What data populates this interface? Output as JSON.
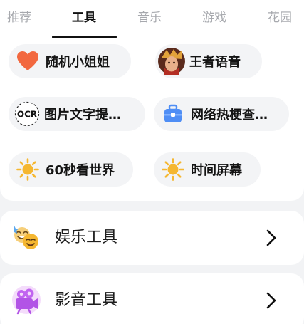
{
  "tabs": [
    {
      "label": "推荐",
      "active": false
    },
    {
      "label": "工具",
      "active": true
    },
    {
      "label": "音乐",
      "active": false
    },
    {
      "label": "游戏",
      "active": false
    },
    {
      "label": "花园",
      "active": false
    }
  ],
  "chips": [
    {
      "label": "随机小姐姐",
      "icon": "heart-icon"
    },
    {
      "label": "王者语音",
      "icon": "game-hero-avatar-icon"
    },
    {
      "label": "图片文字提…",
      "icon": "ocr-icon",
      "icon_text": "OCR"
    },
    {
      "label": "网络热梗查…",
      "icon": "toolbox-icon"
    },
    {
      "label": "60秒看世界",
      "icon": "sun-icon"
    },
    {
      "label": "时间屏幕",
      "icon": "sun-icon"
    }
  ],
  "list": [
    {
      "label": "娱乐工具",
      "icon": "entertainment-emoji-icon"
    },
    {
      "label": "影音工具",
      "icon": "video-camera-icon"
    }
  ],
  "colors": {
    "heart": "#f2683f",
    "sun": "#f5b731",
    "toolbox": "#4f8ef5",
    "video": "#c164f0",
    "active_tab": "#111111",
    "inactive_tab": "#a7a9ae"
  }
}
